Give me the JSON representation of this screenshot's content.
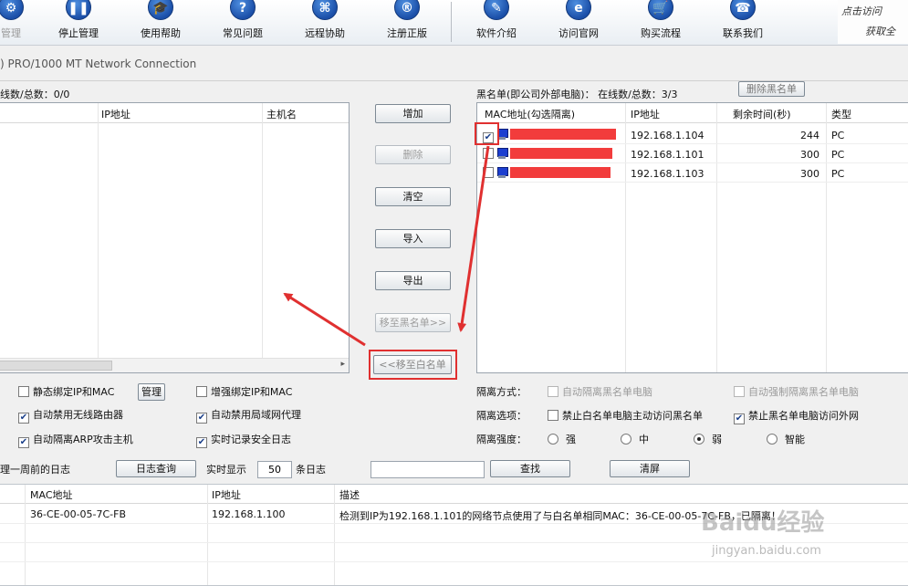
{
  "toolbar": {
    "items": [
      {
        "label": "管理",
        "glyph": "⚙"
      },
      {
        "label": "停止管理",
        "glyph": "❚❚"
      },
      {
        "label": "使用帮助",
        "glyph": "🎓"
      },
      {
        "label": "常见问题",
        "glyph": "?"
      },
      {
        "label": "远程协助",
        "glyph": "⌘"
      },
      {
        "label": "注册正版",
        "glyph": "®"
      },
      {
        "label": "软件介绍",
        "glyph": "✎"
      },
      {
        "label": "访问官网",
        "glyph": "e"
      },
      {
        "label": "购买流程",
        "glyph": "🛒"
      },
      {
        "label": "联系我们",
        "glyph": "☎"
      }
    ],
    "brand_line1": "点击访问",
    "brand_line2": "获取全"
  },
  "adapter": ") PRO/1000 MT Network Connection",
  "whitelist": {
    "caption": "线数/总数：0/0",
    "headers": [
      "IP地址",
      "主机名"
    ]
  },
  "blacklist": {
    "caption": "黑名单(即公司外部电脑)：  在线数/总数：3/3",
    "delete_button": "删除黑名单",
    "headers": [
      "MAC地址(勾选隔离)",
      "IP地址",
      "剩余时间(秒)",
      "类型"
    ],
    "rows": [
      {
        "checked": true,
        "ip": "192.168.1.104",
        "remaining": "244",
        "type": "PC"
      },
      {
        "checked": false,
        "ip": "192.168.1.101",
        "remaining": "300",
        "type": "PC"
      },
      {
        "checked": false,
        "ip": "192.168.1.103",
        "remaining": "300",
        "type": "PC"
      }
    ]
  },
  "middle_buttons": {
    "add": "增加",
    "delete": "删除",
    "clear": "清空",
    "import": "导入",
    "export": "导出",
    "move_to_black": "移至黑名单>>",
    "move_to_white": "<<移至白名单"
  },
  "options_left": {
    "static_bind": "静态绑定IP和MAC",
    "manage_button": "管理",
    "enhanced_bind": "增强绑定IP和MAC",
    "disable_wireless": "自动禁用无线路由器",
    "disable_lan_proxy": "自动禁用局域网代理",
    "isolate_arp": "自动隔离ARP攻击主机",
    "realtime_log": "实时记录安全日志"
  },
  "options_right": {
    "isolation_mode_label": "隔离方式：",
    "auto_isolate_black": "自动隔离黑名单电脑",
    "force_isolate_black": "自动强制隔离黑名单电脑",
    "isolation_options_label": "隔离选项：",
    "forbid_white_to_black": "禁止白名单电脑主动访问黑名单",
    "forbid_black_external": "禁止黑名单电脑访问外网",
    "strength_label": "隔离强度：",
    "strength_options": [
      "强",
      "中",
      "弱",
      "智能"
    ],
    "strength_selected": "弱"
  },
  "log_bar": {
    "prefix": "理一周前的日志",
    "query_button": "日志查询",
    "realtime_label": "实时显示",
    "count": "50",
    "count_suffix": "条日志",
    "search_value": "",
    "search_button": "查找",
    "clear_button": "清屏"
  },
  "log_table": {
    "headers": [
      "MAC地址",
      "IP地址",
      "描述"
    ],
    "rows": [
      {
        "mac": "36-CE-00-05-7C-FB",
        "ip": "192.168.1.100",
        "desc": "检测到IP为192.168.1.101的网络节点使用了与白名单相同MAC：36-CE-00-05-7C-FB，已隔离！"
      }
    ]
  },
  "watermark": {
    "logo": "Baidu经验",
    "url": "jingyan.baidu.com"
  },
  "colors": {
    "highlight": "#e03030",
    "redacted": "#f23c3c",
    "icon_blue": "#1b4fa8"
  }
}
